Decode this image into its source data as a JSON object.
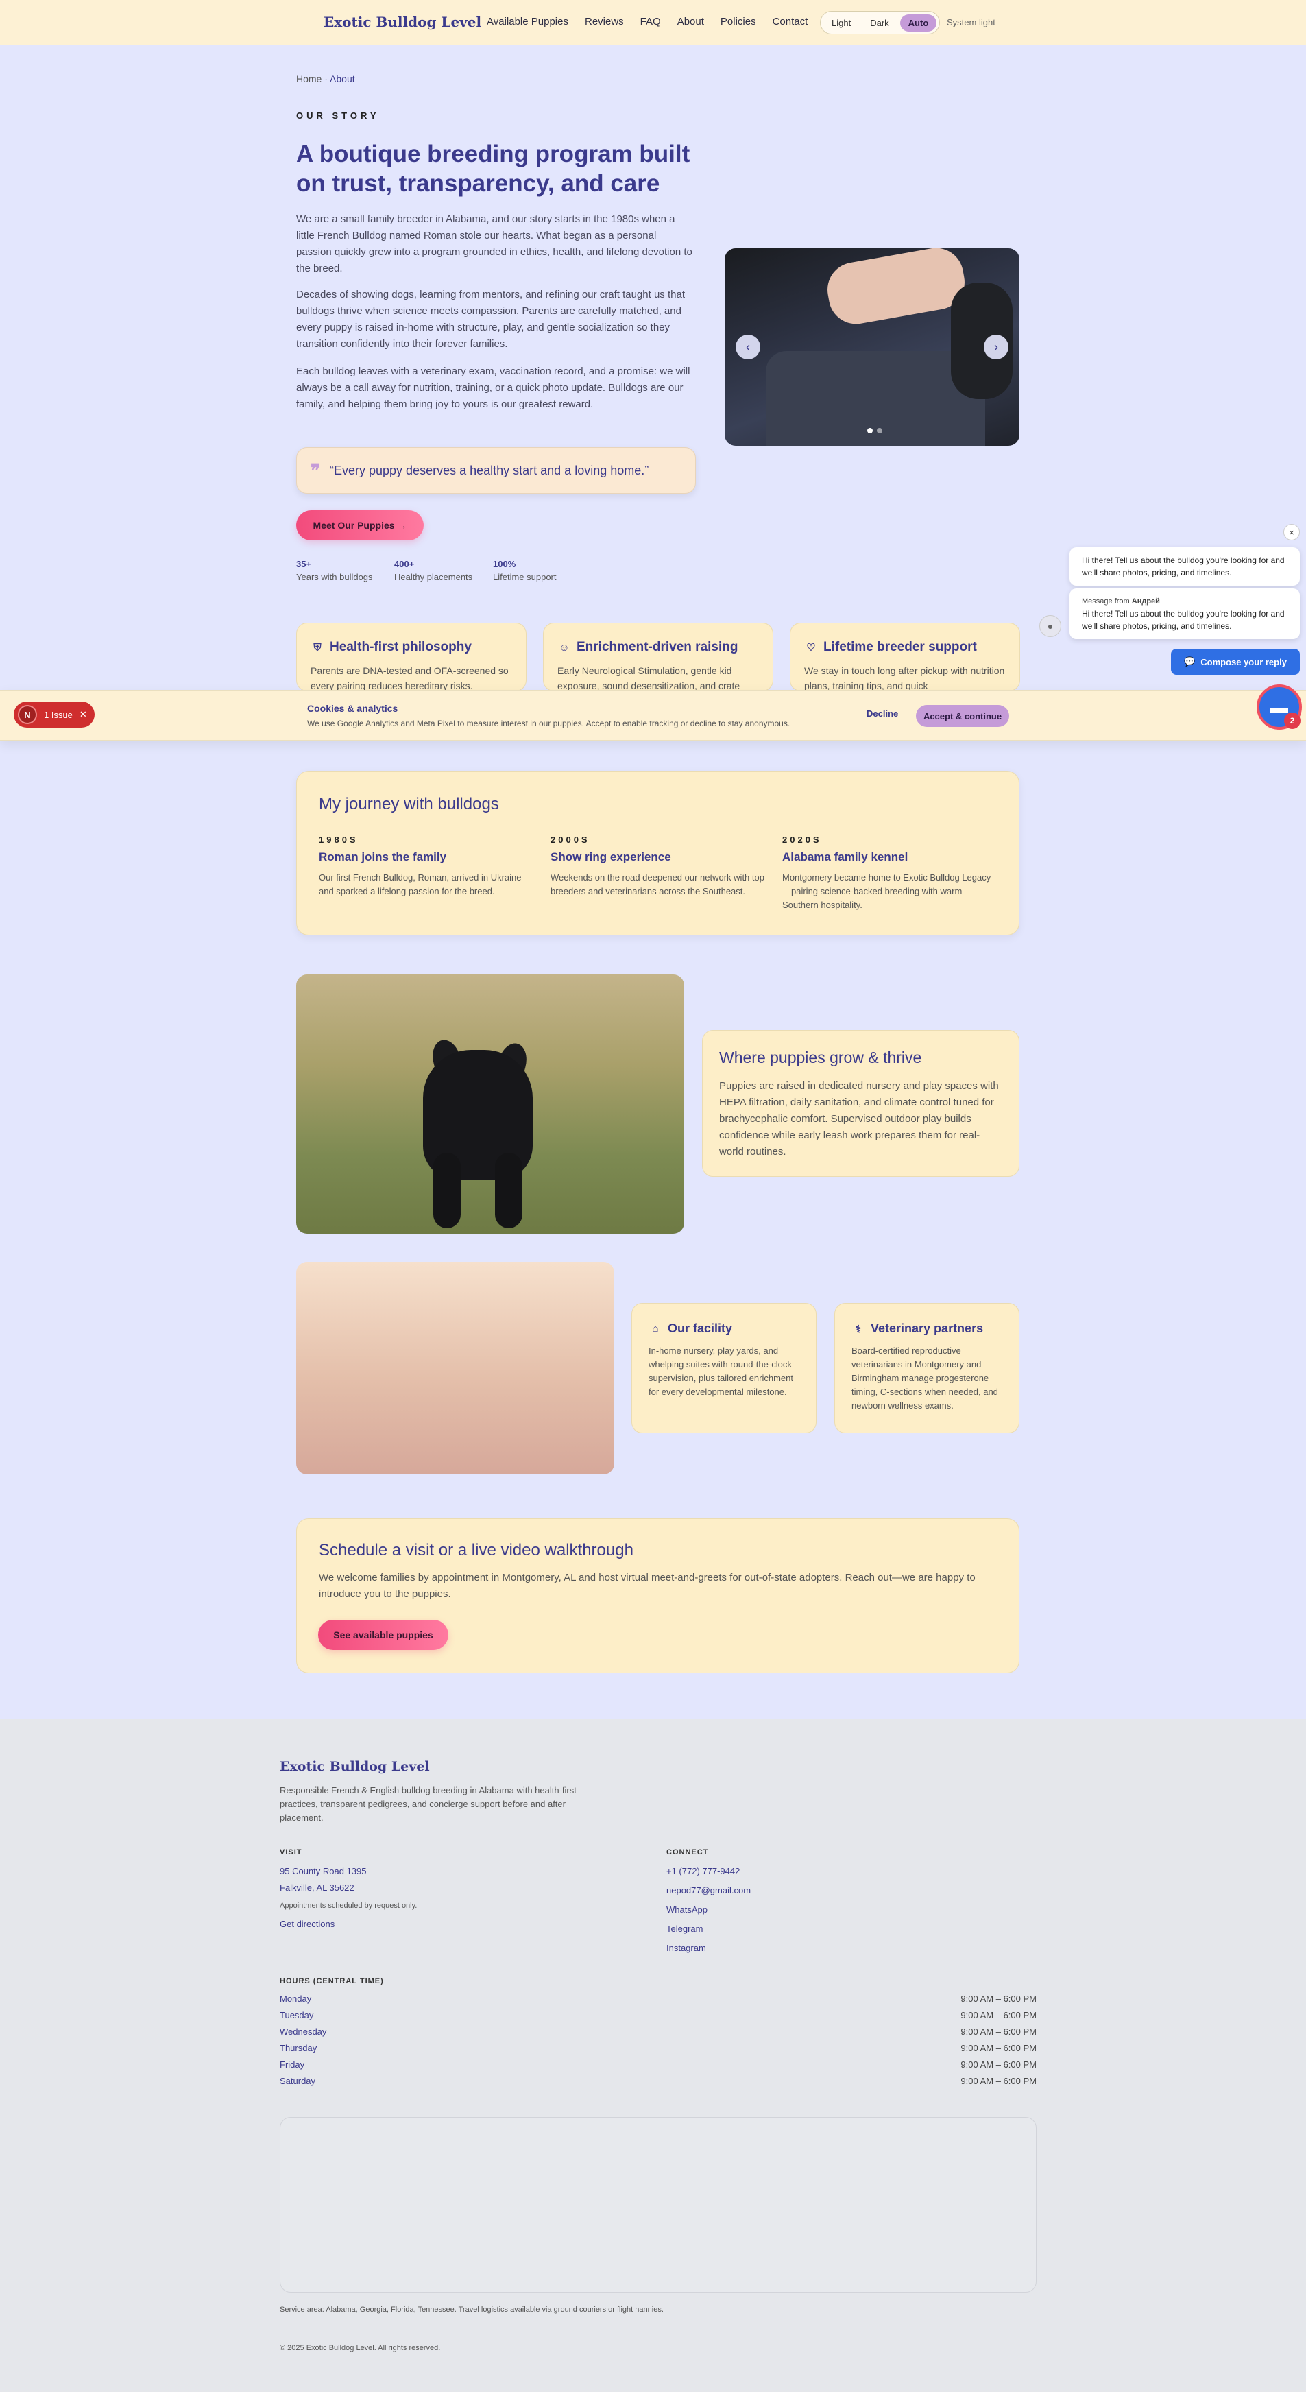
{
  "header": {
    "brand": "Exotic Bulldog Level",
    "nav": [
      "Available Puppies",
      "Reviews",
      "FAQ",
      "About",
      "Policies",
      "Contact"
    ],
    "theme": {
      "options": [
        "Light",
        "Dark",
        "Auto"
      ],
      "selected": "Auto",
      "note": "System light"
    }
  },
  "breadcrumb": {
    "home": "Home",
    "current": "About"
  },
  "hero": {
    "eyebrow": "OUR STORY",
    "title": "A boutique breeding program built on trust, transparency, and care",
    "p1": "We are a small family breeder in Alabama, and our story starts in the 1980s when a little French Bulldog named Roman stole our hearts. What began as a personal passion quickly grew into a program grounded in ethics, health, and lifelong devotion to the breed.",
    "p2": "Decades of showing dogs, learning from mentors, and refining our craft taught us that bulldogs thrive when science meets compassion. Parents are carefully matched, and every puppy is raised in-home with structure, play, and gentle socialization so they transition confidently into their forever families.",
    "p3": "Each bulldog leaves with a veterinary exam, vaccination record, and a promise: we will always be a call away for nutrition, training, or a quick photo update. Bulldogs are our family, and helping them bring joy to yours is our greatest reward.",
    "quote": "“Every puppy deserves a healthy start and a loving home.”",
    "cta": "Meet Our Puppies →",
    "stats": [
      {
        "value": "35+",
        "label": "Years with bulldogs"
      },
      {
        "value": "400+",
        "label": "Healthy placements"
      },
      {
        "value": "100%",
        "label": "Lifetime support"
      }
    ]
  },
  "carousel": {
    "slides": 2,
    "active": 1
  },
  "features": [
    {
      "icon": "shield-icon",
      "title": "Health-first philosophy",
      "text": "Parents are DNA-tested and OFA-screened so every pairing reduces hereditary risks."
    },
    {
      "icon": "smile-icon",
      "title": "Enrichment-driven raising",
      "text": "Early Neurological Stimulation, gentle kid exposure, sound desensitization, and crate"
    },
    {
      "icon": "heart-icon",
      "title": "Lifetime breeder support",
      "text": "We stay in touch long after pickup with nutrition plans, training tips, and quick"
    }
  ],
  "cookie": {
    "issue": "1 Issue",
    "issue_badge": "N",
    "title": "Cookies & analytics",
    "text": "We use Google Analytics and Meta Pixel to measure interest in our puppies. Accept to enable tracking or decline to stay anonymous.",
    "decline": "Decline",
    "accept": "Accept & continue"
  },
  "chat": {
    "close": "×",
    "msg1": "Hi there! Tell us about the bulldog you're looking for and we'll share photos, pricing, and timelines.",
    "from_prefix": "Message from",
    "from_name": "Андрей",
    "msg2": "Hi there! Tell us about the bulldog you're looking for and we'll share photos, pricing, and timelines.",
    "compose": "Compose your reply",
    "badge": "2"
  },
  "journey": {
    "title": "My journey with bulldogs",
    "items": [
      {
        "year": "1980S",
        "title": "Roman joins the family",
        "text": "Our first French Bulldog, Roman, arrived in Ukraine and sparked a lifelong passion for the breed."
      },
      {
        "year": "2000S",
        "title": "Show ring experience",
        "text": "Weekends on the road deepened our network with top breeders and veterinarians across the Southeast."
      },
      {
        "year": "2020S",
        "title": "Alabama family kennel",
        "text": "Montgomery became home to Exotic Bulldog Legacy—pairing science-backed breeding with warm Southern hospitality."
      }
    ]
  },
  "grow": {
    "title": "Where puppies grow & thrive",
    "text": "Puppies are raised in dedicated nursery and play spaces with HEPA filtration, daily sanitation, and climate control tuned for brachycephalic comfort. Supervised outdoor play builds confidence while early leash work prepares them for real-world routines."
  },
  "services": [
    {
      "icon": "home-icon",
      "title": "Our facility",
      "text": "In-home nursery, play yards, and whelping suites with round-the-clock supervision, plus tailored enrichment for every developmental milestone."
    },
    {
      "icon": "stethoscope-icon",
      "title": "Veterinary partners",
      "text": "Board-certified reproductive veterinarians in Montgomery and Birmingham manage progesterone timing, C-sections when needed, and newborn wellness exams."
    }
  ],
  "visit": {
    "title": "Schedule a visit or a live video walkthrough",
    "text": "We welcome families by appointment in Montgomery, AL and host virtual meet-and-greets for out-of-state adopters. Reach out—we are happy to introduce you to the puppies.",
    "cta": "See available puppies"
  },
  "footer": {
    "brand": "Exotic Bulldog Level",
    "desc": "Responsible French & English bulldog breeding in Alabama with health-first practices, transparent pedigrees, and concierge support before and after placement.",
    "visit_h": "VISIT",
    "addr1": "95 County Road 1395",
    "addr2": "Falkville, AL 35622",
    "appt": "Appointments scheduled by request only.",
    "directions": "Get directions",
    "connect_h": "CONNECT",
    "phone": "+1 (772) 777-9442",
    "email": "nepod77@gmail.com",
    "whatsapp": "WhatsApp",
    "telegram": "Telegram",
    "instagram": "Instagram",
    "hours_h": "HOURS (CENTRAL TIME)",
    "hours": [
      {
        "day": "Monday",
        "time": "9:00 AM – 6:00 PM"
      },
      {
        "day": "Tuesday",
        "time": "9:00 AM – 6:00 PM"
      },
      {
        "day": "Wednesday",
        "time": "9:00 AM – 6:00 PM"
      },
      {
        "day": "Thursday",
        "time": "9:00 AM – 6:00 PM"
      },
      {
        "day": "Friday",
        "time": "9:00 AM – 6:00 PM"
      },
      {
        "day": "Saturday",
        "time": "9:00 AM – 6:00 PM"
      }
    ],
    "area": "Service area: Alabama, Georgia, Florida, Tennessee. Travel logistics available via ground couriers or flight nannies.",
    "copyright": "© 2025 Exotic Bulldog Level. All rights reserved."
  }
}
